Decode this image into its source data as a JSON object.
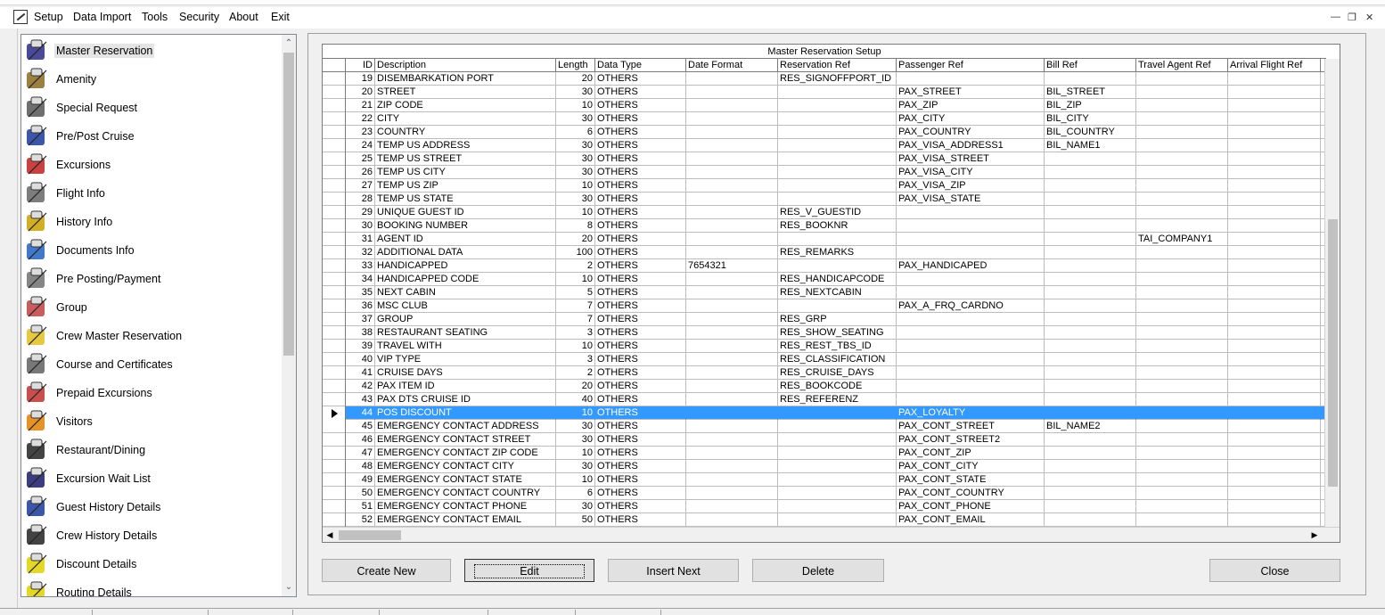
{
  "menu": [
    "Setup",
    "Data Import",
    "Tools",
    "Security",
    "About",
    "Exit"
  ],
  "sidebar": {
    "items": [
      {
        "label": "Master Reservation",
        "icon": "master-reservation-icon",
        "selected": true
      },
      {
        "label": "Amenity",
        "icon": "amenity-icon"
      },
      {
        "label": "Special Request",
        "icon": "special-request-icon"
      },
      {
        "label": "Pre/Post Cruise",
        "icon": "pre-post-cruise-icon"
      },
      {
        "label": "Excursions",
        "icon": "excursions-icon"
      },
      {
        "label": "Flight Info",
        "icon": "flight-info-icon"
      },
      {
        "label": "History Info",
        "icon": "history-info-icon"
      },
      {
        "label": "Documents Info",
        "icon": "documents-info-icon"
      },
      {
        "label": "Pre Posting/Payment",
        "icon": "pre-posting-payment-icon"
      },
      {
        "label": "Group",
        "icon": "group-icon"
      },
      {
        "label": "Crew Master Reservation",
        "icon": "crew-master-reservation-icon"
      },
      {
        "label": "Course and Certificates",
        "icon": "course-certificates-icon"
      },
      {
        "label": "Prepaid Excursions",
        "icon": "prepaid-excursions-icon"
      },
      {
        "label": "Visitors",
        "icon": "visitors-icon"
      },
      {
        "label": "Restaurant/Dining",
        "icon": "restaurant-dining-icon"
      },
      {
        "label": "Excursion Wait List",
        "icon": "excursion-wait-list-icon"
      },
      {
        "label": "Guest History Details",
        "icon": "guest-history-details-icon"
      },
      {
        "label": "Crew History Details",
        "icon": "crew-history-details-icon"
      },
      {
        "label": "Discount Details",
        "icon": "discount-details-icon"
      },
      {
        "label": "Routing Details",
        "icon": "routing-details-icon"
      }
    ]
  },
  "grid": {
    "title": "Master Reservation Setup",
    "columns": [
      "ID",
      "Description",
      "Length",
      "Data Type",
      "Date Format",
      "Reservation Ref",
      "Passenger Ref",
      "Bill Ref",
      "Travel Agent Ref",
      "Arrival Flight Ref"
    ],
    "rows": [
      [
        "19",
        "DISEMBARKATION PORT",
        "20",
        "OTHERS",
        "",
        "RES_SIGNOFFPORT_ID",
        "",
        "",
        "",
        ""
      ],
      [
        "20",
        "STREET",
        "30",
        "OTHERS",
        "",
        "",
        "PAX_STREET",
        "BIL_STREET",
        "",
        ""
      ],
      [
        "21",
        "ZIP CODE",
        "10",
        "OTHERS",
        "",
        "",
        "PAX_ZIP",
        "BIL_ZIP",
        "",
        ""
      ],
      [
        "22",
        "CITY",
        "30",
        "OTHERS",
        "",
        "",
        "PAX_CITY",
        "BIL_CITY",
        "",
        ""
      ],
      [
        "23",
        "COUNTRY",
        "6",
        "OTHERS",
        "",
        "",
        "PAX_COUNTRY",
        "BIL_COUNTRY",
        "",
        ""
      ],
      [
        "24",
        "TEMP US ADDRESS",
        "30",
        "OTHERS",
        "",
        "",
        "PAX_VISA_ADDRESS1",
        "BIL_NAME1",
        "",
        ""
      ],
      [
        "25",
        "TEMP US STREET",
        "30",
        "OTHERS",
        "",
        "",
        "PAX_VISA_STREET",
        "",
        "",
        ""
      ],
      [
        "26",
        "TEMP US CITY",
        "30",
        "OTHERS",
        "",
        "",
        "PAX_VISA_CITY",
        "",
        "",
        ""
      ],
      [
        "27",
        "TEMP US ZIP",
        "10",
        "OTHERS",
        "",
        "",
        "PAX_VISA_ZIP",
        "",
        "",
        ""
      ],
      [
        "28",
        "TEMP US STATE",
        "30",
        "OTHERS",
        "",
        "",
        "PAX_VISA_STATE",
        "",
        "",
        ""
      ],
      [
        "29",
        "UNIQUE GUEST ID",
        "10",
        "OTHERS",
        "",
        "RES_V_GUESTID",
        "",
        "",
        "",
        ""
      ],
      [
        "30",
        "BOOKING NUMBER",
        "8",
        "OTHERS",
        "",
        "RES_BOOKNR",
        "",
        "",
        "",
        ""
      ],
      [
        "31",
        "AGENT ID",
        "20",
        "OTHERS",
        "",
        "",
        "",
        "",
        "TAI_COMPANY1",
        ""
      ],
      [
        "32",
        "ADDITIONAL DATA",
        "100",
        "OTHERS",
        "",
        "RES_REMARKS",
        "",
        "",
        "",
        ""
      ],
      [
        "33",
        "HANDICAPPED",
        "2",
        "OTHERS",
        "7654321",
        "",
        "PAX_HANDICAPED",
        "",
        "",
        ""
      ],
      [
        "34",
        "HANDICAPPED CODE",
        "10",
        "OTHERS",
        "",
        "RES_HANDICAPCODE",
        "",
        "",
        "",
        ""
      ],
      [
        "35",
        "NEXT CABIN",
        "5",
        "OTHERS",
        "",
        "RES_NEXTCABIN",
        "",
        "",
        "",
        ""
      ],
      [
        "36",
        "MSC CLUB",
        "7",
        "OTHERS",
        "",
        "",
        "PAX_A_FRQ_CARDNO",
        "",
        "",
        ""
      ],
      [
        "37",
        "GROUP",
        "7",
        "OTHERS",
        "",
        "RES_GRP",
        "",
        "",
        "",
        ""
      ],
      [
        "38",
        "RESTAURANT SEATING",
        "3",
        "OTHERS",
        "",
        "RES_SHOW_SEATING",
        "",
        "",
        "",
        ""
      ],
      [
        "39",
        "TRAVEL WITH",
        "10",
        "OTHERS",
        "",
        "RES_REST_TBS_ID",
        "",
        "",
        "",
        ""
      ],
      [
        "40",
        "VIP TYPE",
        "3",
        "OTHERS",
        "",
        "RES_CLASSIFICATION",
        "",
        "",
        "",
        ""
      ],
      [
        "41",
        "CRUISE DAYS",
        "2",
        "OTHERS",
        "",
        "RES_CRUISE_DAYS",
        "",
        "",
        "",
        ""
      ],
      [
        "42",
        "PAX ITEM ID",
        "20",
        "OTHERS",
        "",
        "RES_BOOKCODE",
        "",
        "",
        "",
        ""
      ],
      [
        "43",
        "PAX DTS CRUISE ID",
        "40",
        "OTHERS",
        "",
        "RES_REFERENZ",
        "",
        "",
        "",
        ""
      ],
      [
        "44",
        "POS DISCOUNT",
        "10",
        "OTHERS",
        "",
        "",
        "PAX_LOYALTY",
        "",
        "",
        ""
      ],
      [
        "45",
        "EMERGENCY CONTACT ADDRESS",
        "30",
        "OTHERS",
        "",
        "",
        "PAX_CONT_STREET",
        "BIL_NAME2",
        "",
        ""
      ],
      [
        "46",
        "EMERGENCY CONTACT STREET",
        "30",
        "OTHERS",
        "",
        "",
        "PAX_CONT_STREET2",
        "",
        "",
        ""
      ],
      [
        "47",
        "EMERGENCY CONTACT ZIP CODE",
        "10",
        "OTHERS",
        "",
        "",
        "PAX_CONT_ZIP",
        "",
        "",
        ""
      ],
      [
        "48",
        "EMERGENCY CONTACT CITY",
        "30",
        "OTHERS",
        "",
        "",
        "PAX_CONT_CITY",
        "",
        "",
        ""
      ],
      [
        "49",
        "EMERGENCY CONTACT STATE",
        "10",
        "OTHERS",
        "",
        "",
        "PAX_CONT_STATE",
        "",
        "",
        ""
      ],
      [
        "50",
        "EMERGENCY CONTACT COUNTRY",
        "6",
        "OTHERS",
        "",
        "",
        "PAX_CONT_COUNTRY",
        "",
        "",
        ""
      ],
      [
        "51",
        "EMERGENCY CONTACT PHONE",
        "30",
        "OTHERS",
        "",
        "",
        "PAX_CONT_PHONE",
        "",
        "",
        ""
      ],
      [
        "52",
        "EMERGENCY CONTACT EMAIL",
        "50",
        "OTHERS",
        "",
        "",
        "PAX_CONT_EMAIL",
        "",
        "",
        ""
      ]
    ],
    "selected_id": "44",
    "selection_color": "#3399ff"
  },
  "buttons": {
    "create_new": "Create New",
    "edit": "Edit",
    "insert_next": "Insert Next",
    "delete": "Delete",
    "close": "Close"
  }
}
